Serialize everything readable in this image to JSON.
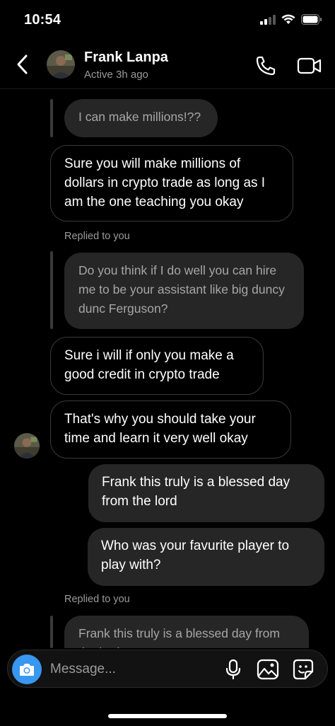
{
  "status_bar": {
    "time": "10:54"
  },
  "header": {
    "contact_name": "Frank Lanpa",
    "contact_status": "Active 3h ago",
    "icons": {
      "back": "chevron-left-icon",
      "call": "phone-icon",
      "video": "video-camera-icon"
    }
  },
  "messages": [
    {
      "type": "quoted",
      "text": "I can make millions!??"
    },
    {
      "type": "received",
      "text": "Sure you will make millions of dollars in crypto trade as long as I am the one teaching you okay"
    },
    {
      "type": "reply_label",
      "text": "Replied to you"
    },
    {
      "type": "quoted",
      "text": "Do you think if I do well you can hire me to be your assistant like big duncy dunc Ferguson?"
    },
    {
      "type": "received",
      "text": "Sure i will if only you make a good credit in crypto trade"
    },
    {
      "type": "received",
      "text": "That's why you should take your time and learn it very well okay"
    },
    {
      "type": "sent",
      "text": "Frank this truly is a blessed day from the lord"
    },
    {
      "type": "sent",
      "text": "Who was your favurite player to play with?"
    },
    {
      "type": "reply_label",
      "text": "Replied to you"
    },
    {
      "type": "quoted",
      "text": "Frank this truly is a blessed day from the lord"
    }
  ],
  "composer": {
    "placeholder": "Message...",
    "icons": [
      "camera-icon",
      "microphone-icon",
      "gallery-icon",
      "sticker-icon"
    ]
  },
  "colors": {
    "background": "#000000",
    "bubble_sent": "#262626",
    "bubble_border": "#3a3a3a",
    "accent": "#3897f0"
  }
}
